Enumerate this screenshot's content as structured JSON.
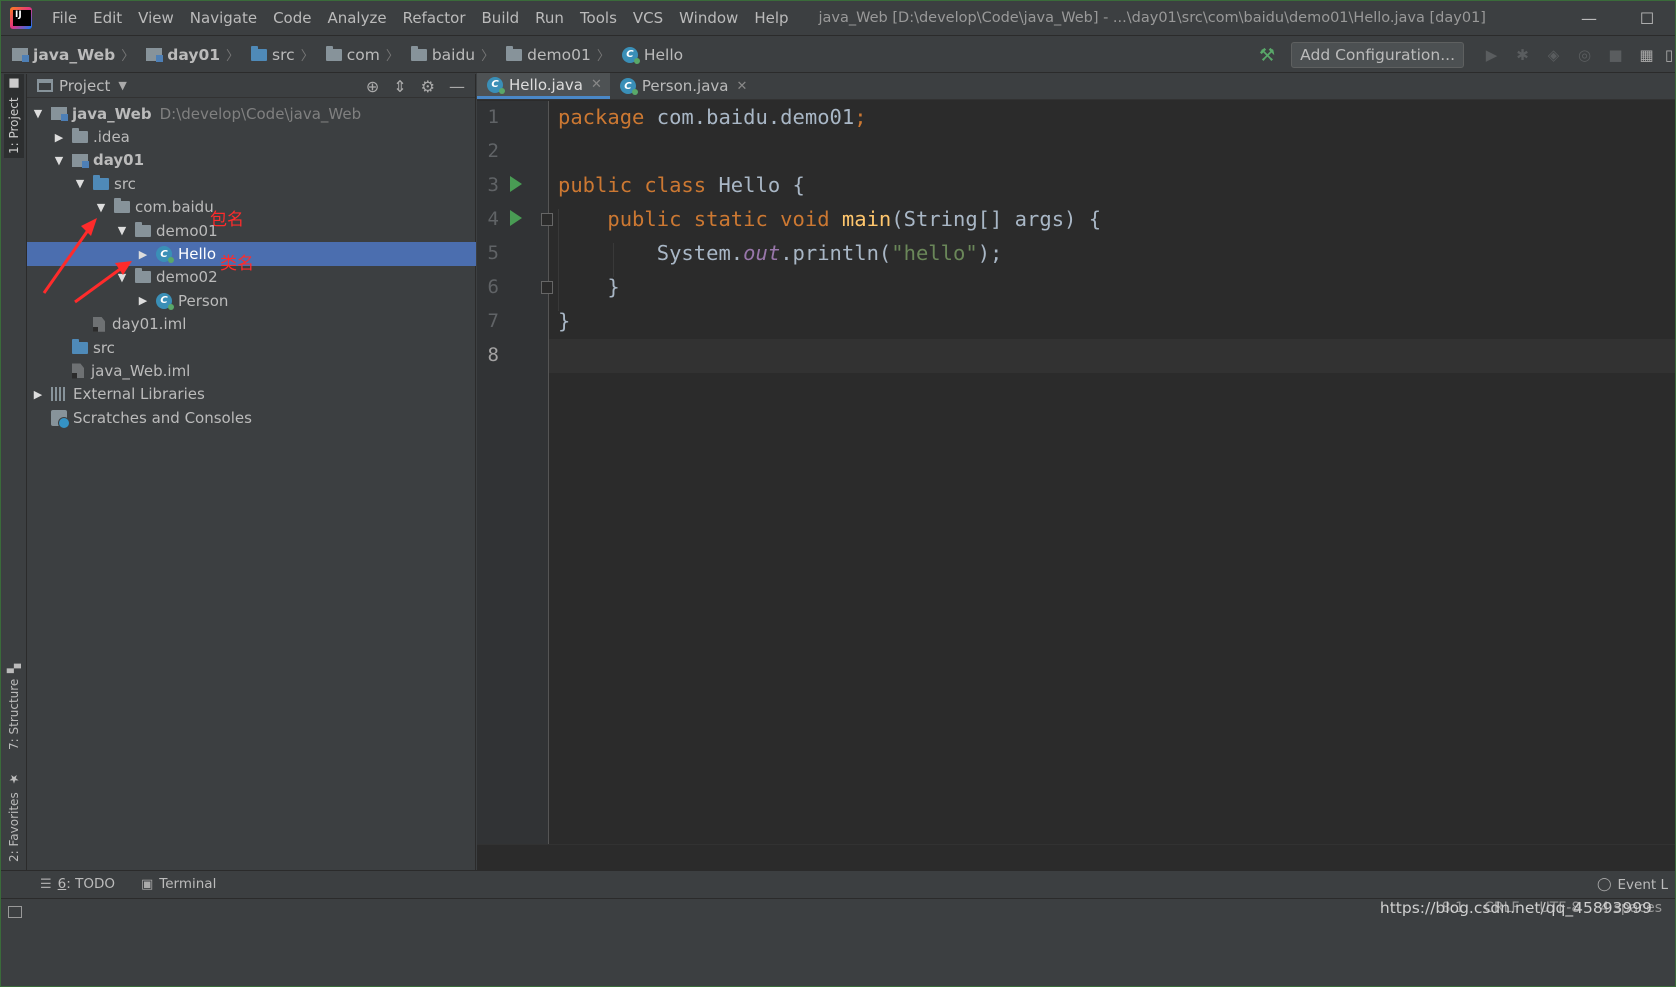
{
  "window": {
    "title": "java_Web [D:\\develop\\Code\\java_Web] - ...\\day01\\src\\com\\baidu\\demo01\\Hello.java [day01]",
    "minimize": "—",
    "maximize": "☐"
  },
  "menu": [
    "File",
    "Edit",
    "View",
    "Navigate",
    "Code",
    "Analyze",
    "Refactor",
    "Build",
    "Run",
    "Tools",
    "VCS",
    "Window",
    "Help"
  ],
  "breadcrumbs": [
    "java_Web",
    "day01",
    "src",
    "com",
    "baidu",
    "demo01",
    "Hello"
  ],
  "toolbar": {
    "add_configuration": "Add Configuration..."
  },
  "left_strip": {
    "project": "1: Project",
    "structure": "7: Structure",
    "favorites": "2: Favorites"
  },
  "project_panel": {
    "title": "Project",
    "tree": [
      {
        "label": "java_Web",
        "path": "D:\\develop\\Code\\java_Web"
      },
      {
        "label": ".idea"
      },
      {
        "label": "day01"
      },
      {
        "label": "src"
      },
      {
        "label": "com.baidu"
      },
      {
        "label": "demo01"
      },
      {
        "label": "Hello"
      },
      {
        "label": "demo02"
      },
      {
        "label": "Person"
      },
      {
        "label": "day01.iml"
      },
      {
        "label": "src"
      },
      {
        "label": "java_Web.iml"
      },
      {
        "label": "External Libraries"
      },
      {
        "label": "Scratches and Consoles"
      }
    ],
    "annotations": {
      "package_name": "包名",
      "class_name": "类名"
    },
    "annotation_color": "#ff2b2b"
  },
  "editor": {
    "tabs": [
      {
        "label": "Hello.java",
        "active": true
      },
      {
        "label": "Person.java",
        "active": false
      }
    ],
    "line_numbers": [
      "1",
      "2",
      "3",
      "4",
      "5",
      "6",
      "7",
      "8"
    ],
    "code": {
      "l1_kw": "package",
      "l1_rest": " com.baidu.demo01",
      "l1_semi": ";",
      "l3_kw": "public class",
      "l3_rest": " Hello {",
      "l4_kw": "public static void",
      "l4_fn": "main",
      "l4_rest": "(String[] args) {",
      "l5_a": "System.",
      "l5_out": "out",
      "l5_b": ".println(",
      "l5_str": "\"hello\"",
      "l5_c": ");",
      "l6": "}",
      "l7": "}"
    },
    "colors": {
      "keyword": "#cc7832",
      "function": "#ffc66d",
      "string": "#6a8759",
      "static_field": "#9876aa",
      "text": "#a9b7c6"
    }
  },
  "tool_windows": {
    "todo_num": "6",
    "todo_label": ": TODO",
    "terminal": "Terminal",
    "event_log": "Event L"
  },
  "statusbar": {
    "position": "8:1",
    "line_sep": "CRLF",
    "encoding": "UTF-8",
    "indent": "4 spaces",
    "watermark": "https://blog.csdn.net/qq_45893999"
  }
}
